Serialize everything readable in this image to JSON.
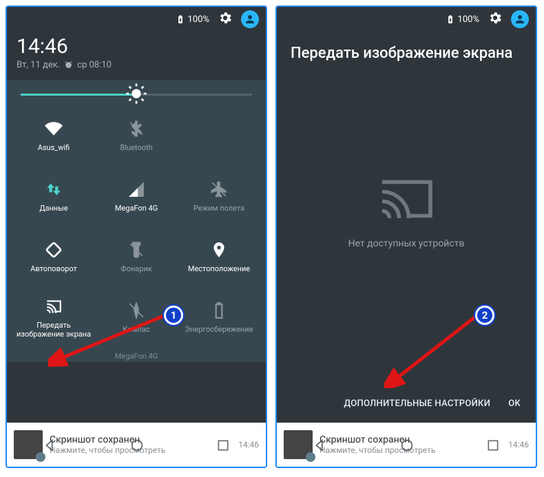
{
  "statusbar": {
    "battery_pct": "100%"
  },
  "clock": {
    "time": "14:46",
    "date": "Вт, 11 дек.",
    "alarm": "ср 08:10"
  },
  "tiles": {
    "wifi": "Asus_wifi",
    "bluetooth": "Bluetooth",
    "data": "Данные",
    "signal": "MegaFon 4G",
    "airplane": "Режим полета",
    "rotate": "Автоповорот",
    "flash": "Фонарик",
    "location": "Местоположение",
    "cast": "Передать изображение экрана",
    "compass": "Компас",
    "battery": "Энергосбережение"
  },
  "carrier": "MegaFon 4G",
  "notif": {
    "title": "Скриншот сохранен",
    "sub": "Нажмите, чтобы просмотреть",
    "time": "14:46"
  },
  "cast": {
    "title": "Передать изображение экрана",
    "empty": "Нет доступных устройств",
    "more": "ДОПОЛНИТЕЛЬНЫЕ НАСТРОЙКИ",
    "ok": "OK"
  },
  "callouts": {
    "one": "1",
    "two": "2"
  }
}
